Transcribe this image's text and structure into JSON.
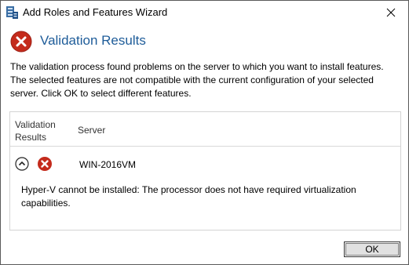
{
  "window": {
    "title": "Add Roles and Features Wizard"
  },
  "header": {
    "title": "Validation Results",
    "icon": "error-icon"
  },
  "intro": {
    "line1": "The validation process found problems on the server to which you want to install features.",
    "line2": "The selected features are not compatible with the current configuration of your selected",
    "line3": "server.  Click OK to select different features."
  },
  "results": {
    "columns": {
      "validation_results_line1": "Validation",
      "validation_results_line2": "Results",
      "server": "Server"
    },
    "rows": [
      {
        "status_icon": "error-icon",
        "server": "WIN-2016VM",
        "message_line1": "Hyper-V cannot be installed: The processor does not have required virtualization",
        "message_line2": "capabilities."
      }
    ]
  },
  "buttons": {
    "ok_label": "OK"
  },
  "colors": {
    "heading": "#1e5c99",
    "error_red": "#c42b1c"
  }
}
